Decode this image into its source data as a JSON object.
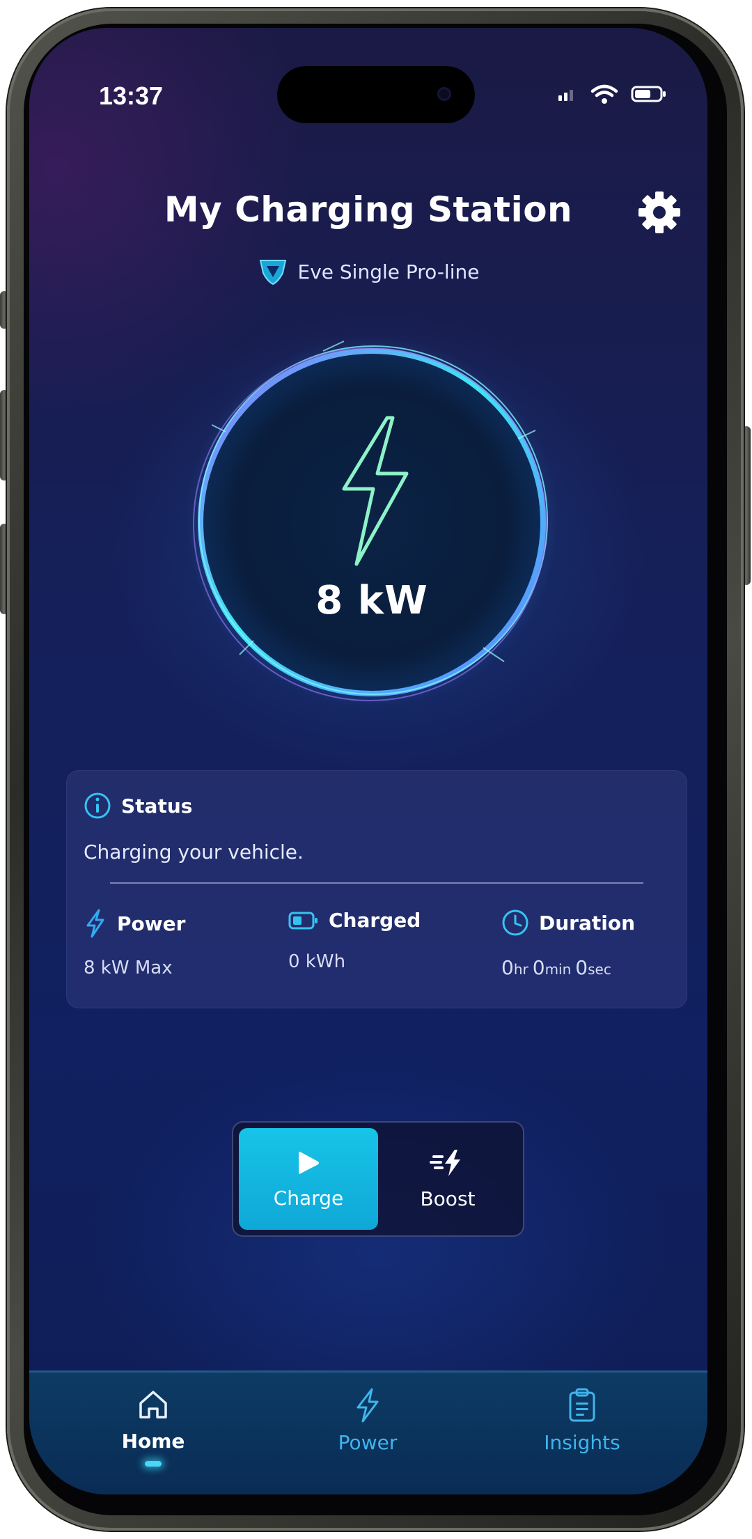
{
  "status_bar": {
    "time": "13:37"
  },
  "header": {
    "title": "My Charging Station",
    "model_name": "Eve Single Pro-line"
  },
  "gauge": {
    "power_readout": "8 kW"
  },
  "status_card": {
    "status_label": "Status",
    "status_text": "Charging your vehicle.",
    "stats": [
      {
        "label": "Power",
        "value": "8 kW Max"
      },
      {
        "label": "Charged",
        "value": "0 kWh"
      },
      {
        "label": "Duration",
        "hr": "0",
        "hr_unit": "hr",
        "min": "0",
        "min_unit": "min",
        "sec": "0",
        "sec_unit": "sec"
      }
    ]
  },
  "mode_toggle": {
    "charge_label": "Charge",
    "boost_label": "Boost",
    "selected": "Charge"
  },
  "bottom_nav": {
    "items": [
      {
        "label": "Home",
        "active": true
      },
      {
        "label": "Power",
        "active": false
      },
      {
        "label": "Insights",
        "active": false
      }
    ]
  },
  "colors": {
    "accent_cyan": "#17c4e6",
    "nav_label": "#3fb5ec",
    "background": "#15205a"
  },
  "icons": {
    "settings": "gear-icon",
    "model": "shield-icon",
    "gauge": "lightning-bolt-icon",
    "status": "info-icon",
    "power": "lightning-icon",
    "charged": "battery-icon",
    "duration": "clock-icon",
    "charge": "play-icon",
    "boost": "fast-bolt-icon",
    "home": "home-icon",
    "nav_power": "lightning-icon",
    "insights": "clipboard-icon"
  }
}
